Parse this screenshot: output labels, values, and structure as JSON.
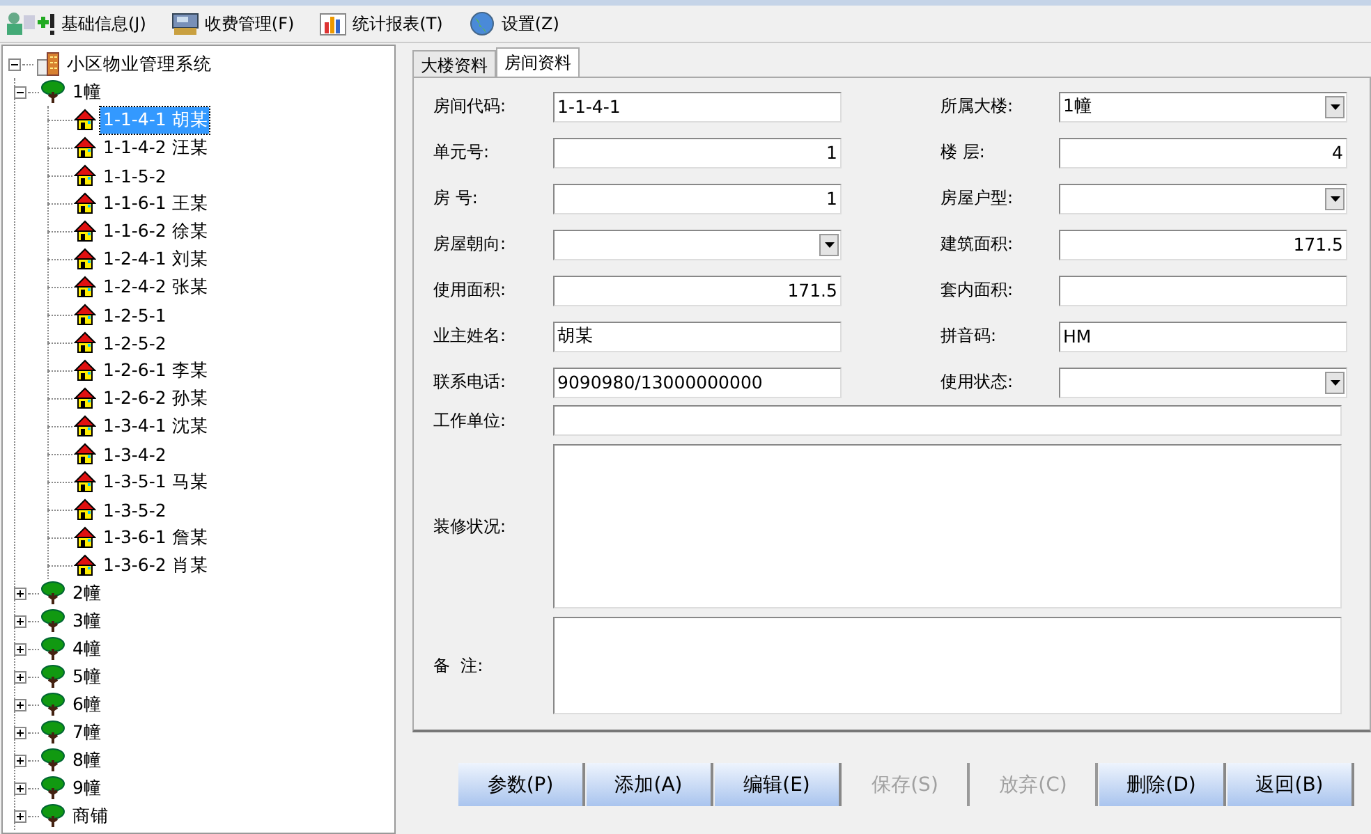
{
  "menu": [
    {
      "label": "基础信息(J)"
    },
    {
      "label": "收费管理(F)"
    },
    {
      "label": "统计报表(T)"
    },
    {
      "label": "设置(Z)"
    }
  ],
  "tree": {
    "label": "小区物业管理系统",
    "kind": "root",
    "expanded": true,
    "selected": false,
    "children": [
      {
        "label": "1幢",
        "kind": "building",
        "expanded": true,
        "selected": false,
        "children": [
          {
            "label": "1-1-4-1 胡某",
            "kind": "room",
            "selected": true
          },
          {
            "label": "1-1-4-2 汪某",
            "kind": "room",
            "selected": false
          },
          {
            "label": "1-1-5-2",
            "kind": "room",
            "selected": false
          },
          {
            "label": "1-1-6-1 王某",
            "kind": "room",
            "selected": false
          },
          {
            "label": "1-1-6-2 徐某",
            "kind": "room",
            "selected": false
          },
          {
            "label": "1-2-4-1 刘某",
            "kind": "room",
            "selected": false
          },
          {
            "label": "1-2-4-2 张某",
            "kind": "room",
            "selected": false
          },
          {
            "label": "1-2-5-1",
            "kind": "room",
            "selected": false
          },
          {
            "label": "1-2-5-2",
            "kind": "room",
            "selected": false
          },
          {
            "label": "1-2-6-1 李某",
            "kind": "room",
            "selected": false
          },
          {
            "label": "1-2-6-2 孙某",
            "kind": "room",
            "selected": false
          },
          {
            "label": "1-3-4-1 沈某",
            "kind": "room",
            "selected": false
          },
          {
            "label": "1-3-4-2",
            "kind": "room",
            "selected": false
          },
          {
            "label": "1-3-5-1 马某",
            "kind": "room",
            "selected": false
          },
          {
            "label": "1-3-5-2",
            "kind": "room",
            "selected": false
          },
          {
            "label": "1-3-6-1 詹某",
            "kind": "room",
            "selected": false
          },
          {
            "label": "1-3-6-2 肖某",
            "kind": "room",
            "selected": false
          }
        ]
      },
      {
        "label": "2幢",
        "kind": "building",
        "expanded": false,
        "selected": false
      },
      {
        "label": "3幢",
        "kind": "building",
        "expanded": false,
        "selected": false
      },
      {
        "label": "4幢",
        "kind": "building",
        "expanded": false,
        "selected": false
      },
      {
        "label": "5幢",
        "kind": "building",
        "expanded": false,
        "selected": false
      },
      {
        "label": "6幢",
        "kind": "building",
        "expanded": false,
        "selected": false
      },
      {
        "label": "7幢",
        "kind": "building",
        "expanded": false,
        "selected": false
      },
      {
        "label": "8幢",
        "kind": "building",
        "expanded": false,
        "selected": false
      },
      {
        "label": "9幢",
        "kind": "building",
        "expanded": false,
        "selected": false
      },
      {
        "label": "商铺",
        "kind": "building",
        "expanded": false,
        "selected": false
      }
    ]
  },
  "tabs": [
    {
      "label": "大楼资料",
      "selected": false
    },
    {
      "label": "房间资料",
      "selected": true
    }
  ],
  "form_rows": [
    [
      {
        "label": "房间代码:",
        "kind": "text",
        "value": "1-1-4-1"
      },
      {
        "label": "所属大楼:",
        "kind": "select",
        "value": "1幢"
      }
    ],
    [
      {
        "label": "单元号:",
        "kind": "number",
        "value": "1"
      },
      {
        "label": "楼 层:",
        "kind": "number",
        "value": "4"
      }
    ],
    [
      {
        "label": "房 号:",
        "kind": "number",
        "value": "1"
      },
      {
        "label": "房屋户型:",
        "kind": "select"
      }
    ],
    [
      {
        "label": "房屋朝向:",
        "kind": "select"
      },
      {
        "label": "建筑面积:",
        "kind": "number",
        "value": "171.5"
      }
    ],
    [
      {
        "label": "使用面积:",
        "kind": "number",
        "value": "171.5"
      },
      {
        "label": "套内面积:",
        "kind": "text"
      }
    ],
    [
      {
        "label": "业主姓名:",
        "kind": "text",
        "value": "胡某"
      },
      {
        "label": "拼音码:",
        "kind": "text",
        "value": "HM"
      }
    ],
    [
      {
        "label": "联系电话:",
        "kind": "text",
        "value": "9090980/13000000000"
      },
      {
        "label": "使用状态:",
        "kind": "select"
      }
    ]
  ],
  "wide_fields": [
    {
      "label": "工作单位:",
      "kind": "text"
    },
    {
      "label": "装修状况:",
      "kind": "memo"
    },
    {
      "label": "备  注:",
      "kind": "memo"
    }
  ],
  "buttons": [
    {
      "label": "参数(P)",
      "disabled": false
    },
    {
      "label": "添加(A)",
      "disabled": false
    },
    {
      "label": "编辑(E)",
      "disabled": false
    },
    {
      "label": "保存(S)",
      "disabled": true
    },
    {
      "label": "放弃(C)",
      "disabled": true
    },
    {
      "label": "删除(D)",
      "disabled": false
    },
    {
      "label": "返回(B)",
      "disabled": false
    }
  ]
}
